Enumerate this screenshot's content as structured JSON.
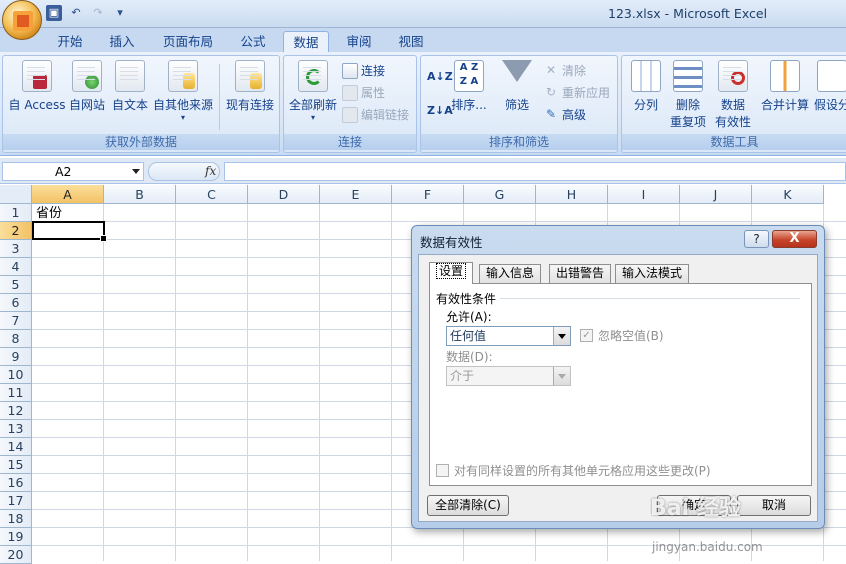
{
  "window": {
    "title": "123.xlsx - Microsoft Excel"
  },
  "tabs": [
    {
      "label": "开始"
    },
    {
      "label": "插入"
    },
    {
      "label": "页面布局"
    },
    {
      "label": "公式"
    },
    {
      "label": "数据",
      "active": true
    },
    {
      "label": "审阅"
    },
    {
      "label": "视图"
    }
  ],
  "ribbon": {
    "external": {
      "label": "获取外部数据",
      "buttons": [
        "自 Access",
        "自网站",
        "自文本",
        "自其他来源",
        "现有连接"
      ]
    },
    "connections": {
      "label": "连接",
      "refresh_all": "全部刷新",
      "connect": "连接",
      "properties": "属性",
      "edit_links": "编辑链接"
    },
    "sort_filter": {
      "label": "排序和筛选",
      "sort": "排序...",
      "filter": "筛选",
      "clear": "清除",
      "reapply": "重新应用",
      "advanced": "高级"
    },
    "data_tools": {
      "label": "数据工具",
      "split": "分列",
      "remove_dup_1": "删除",
      "remove_dup_2": "重复项",
      "validation_1": "数据",
      "validation_2": "有效性",
      "consolidate": "合并计算",
      "whatif": "假设分"
    }
  },
  "formula_bar": {
    "name_box": "A2",
    "fx": "fx",
    "value": ""
  },
  "grid": {
    "columns": [
      "A",
      "B",
      "C",
      "D",
      "E",
      "F",
      "G",
      "H",
      "I",
      "J",
      "K"
    ],
    "rows": [
      "1",
      "2",
      "3",
      "4",
      "5",
      "6",
      "7",
      "8",
      "9",
      "10",
      "11",
      "12",
      "13",
      "14",
      "15",
      "16",
      "17",
      "18",
      "19",
      "20"
    ],
    "a1": "省份"
  },
  "dialog": {
    "title": "数据有效性",
    "help": "?",
    "close": "X",
    "tabs": [
      "设置",
      "输入信息",
      "出错警告",
      "输入法模式"
    ],
    "criteria_title": "有效性条件",
    "allow_label": "允许(A):",
    "allow_value": "任何值",
    "ignore_blank": "忽略空值(B)",
    "data_label": "数据(D):",
    "data_value": "介于",
    "apply_all": "对有同样设置的所有其他单元格应用这些更改(P)",
    "clear_all": "全部清除(C)",
    "ok": "确定",
    "cancel": "取消"
  },
  "watermark": {
    "text": "Bai 经验",
    "url": "jingyan.baidu.com"
  }
}
